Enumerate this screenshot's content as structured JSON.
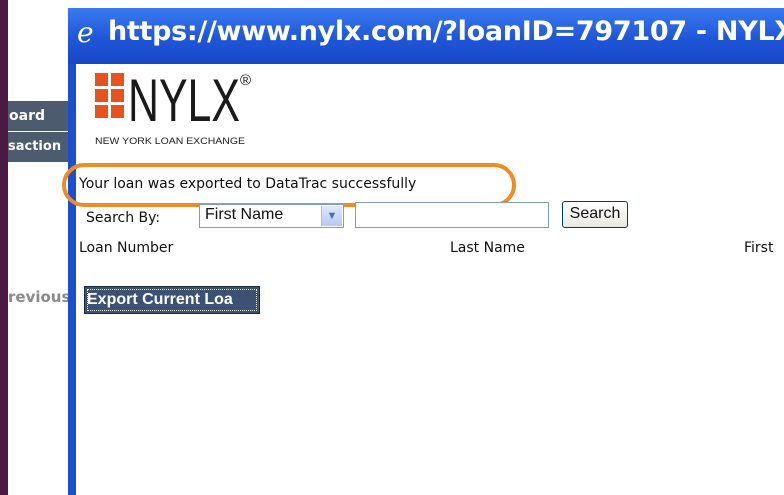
{
  "window": {
    "title": "https://www.nylx.com/?loanID=797107 - NYLX",
    "browser_icon": "ie-e-icon"
  },
  "background": {
    "nav_items": [
      "oard",
      "saction"
    ],
    "previous_label": "revious"
  },
  "logo": {
    "brand": "NYLX",
    "registered": "®",
    "tagline": "NEW YORK LOAN EXCHANGE",
    "colors": {
      "primary": "#e8521c",
      "text": "#1a1a1a"
    }
  },
  "status_message": "Your loan was exported to DataTrac successfully",
  "search": {
    "label": "Search By:",
    "by_selected": "First Name",
    "query": "",
    "button": "Search"
  },
  "columns": [
    "Loan Number",
    "Last Name",
    "First"
  ],
  "actions": {
    "export_label": "Export Current Loa"
  },
  "colors": {
    "highlight_ring": "#f08a24",
    "title_bar": "#1f56d8",
    "export_button": "#3b5275"
  }
}
